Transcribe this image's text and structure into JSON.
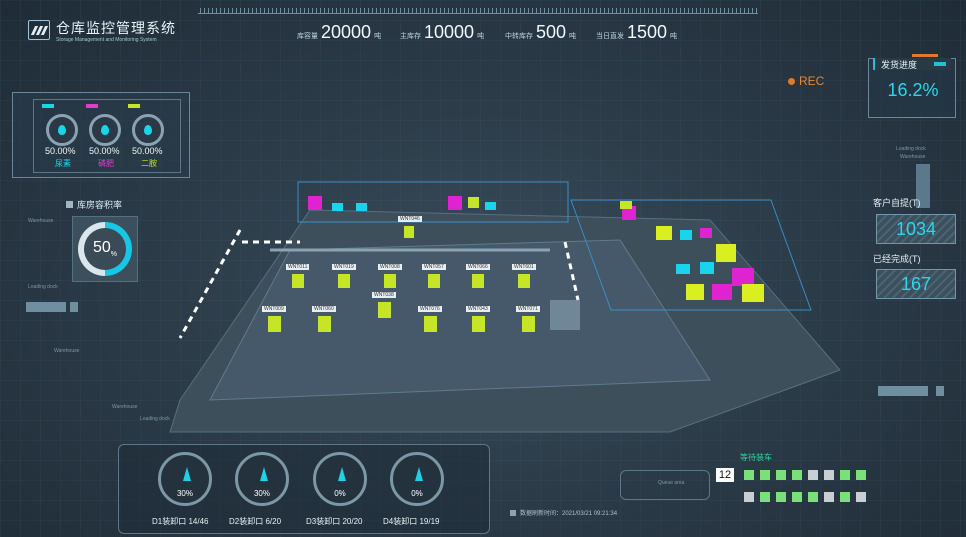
{
  "header": {
    "title": "仓库监控管理系统",
    "subtitle": "Storage Management and Monitoring System",
    "stats": [
      {
        "label": "库容量",
        "value": "20000",
        "unit": "吨"
      },
      {
        "label": "主库存",
        "value": "10000",
        "unit": "吨"
      },
      {
        "label": "中转库存",
        "value": "500",
        "unit": "吨"
      },
      {
        "label": "当日直发",
        "value": "1500",
        "unit": "吨"
      }
    ]
  },
  "left": {
    "gauges": [
      {
        "pct": "50.00%",
        "tag": "尿素",
        "color": "#18d6ea"
      },
      {
        "pct": "50.00%",
        "tag": "磷肥",
        "color": "#e23bd2"
      },
      {
        "pct": "50.00%",
        "tag": "二胺",
        "color": "#c6e526"
      }
    ],
    "volume_title": "库房容积率",
    "volume_pct": "50",
    "volume_unit": "%"
  },
  "right": {
    "progress_title": "发货进度",
    "progress_pct": "16.2%",
    "pickup_label": "客户自提(T)",
    "pickup_value": "1034",
    "done_label": "已经完成(T)",
    "done_value": "167"
  },
  "rec_label": "REC",
  "scene_labels": {
    "loading_dock": "Loading dock",
    "warehouse": "Warehouse",
    "trucks_row1": [
      "WNT011",
      "WNT019",
      "WNT008",
      "WNT057",
      "WNT066",
      "WNT601"
    ],
    "trucks_row2": [
      "WNT009",
      "WNT060",
      "WNT038",
      "WNT076",
      "WNT043",
      "WNT071"
    ],
    "top_truck": "WNT046"
  },
  "docks": [
    {
      "pct": "30%",
      "label": "D1装卸口",
      "count": "14/46",
      "level": 0.3
    },
    {
      "pct": "30%",
      "label": "D2装卸口",
      "count": "6/20",
      "level": 0.3
    },
    {
      "pct": "0%",
      "label": "D3装卸口",
      "count": "20/20",
      "level": 0.0
    },
    {
      "pct": "0%",
      "label": "D4装卸口",
      "count": "19/19",
      "level": 0.0
    }
  ],
  "waiting": {
    "title": "等待装车",
    "count": "12",
    "row1": [
      "g",
      "g",
      "g",
      "g",
      "w",
      "w",
      "g",
      "g"
    ],
    "row2": [
      "w",
      "g",
      "g",
      "g",
      "g",
      "w",
      "g",
      "w"
    ]
  },
  "refresh": "数据刷新时间：2021/03/21 09:21:34",
  "queue_label": "Queue area"
}
